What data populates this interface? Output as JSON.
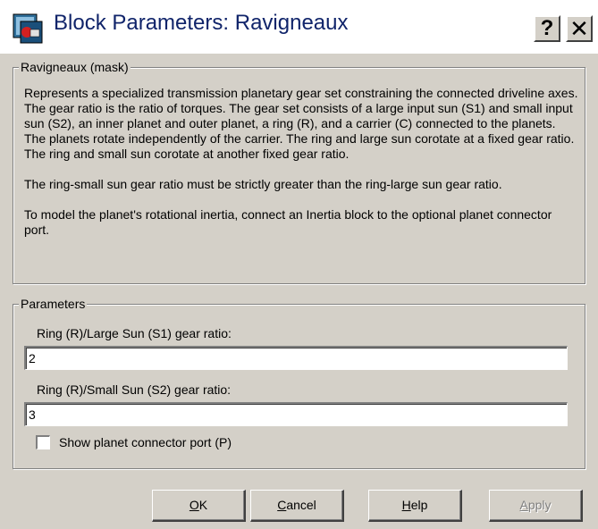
{
  "window": {
    "title": "Block Parameters: Ravigneaux",
    "help_glyph": "?",
    "close_glyph": "✕",
    "app_icon": "simulink-block-icon"
  },
  "mask_group": {
    "legend": "Ravigneaux (mask)",
    "paragraphs": [
      "Represents a specialized transmission planetary gear set constraining the connected driveline axes. The gear ratio is the ratio of torques. The gear set consists of a large input sun (S1) and small input sun (S2), an inner planet and outer planet, a ring (R), and a carrier (C) connected to the planets. The planets rotate independently of the carrier. The ring and large sun corotate at a fixed gear ratio. The ring and small sun corotate at another fixed gear ratio.",
      "The ring-small sun gear ratio must be strictly greater than the ring-large sun gear ratio.",
      "To model the planet's rotational inertia, connect an Inertia block to the optional planet connector port."
    ]
  },
  "params_group": {
    "legend": "Parameters",
    "ratio1_label": "Ring (R)/Large Sun (S1) gear ratio:",
    "ratio1_value": "2",
    "ratio2_label": "Ring (R)/Small Sun (S2) gear ratio:",
    "ratio2_value": "3",
    "checkbox_label": "Show planet connector port (P)",
    "checkbox_checked": false
  },
  "buttons": {
    "ok_first": "O",
    "ok_rest": "K",
    "cancel_first": "C",
    "cancel_rest": "ancel",
    "help_first": "H",
    "help_rest": "elp",
    "apply_first": "A",
    "apply_rest": "pply"
  }
}
